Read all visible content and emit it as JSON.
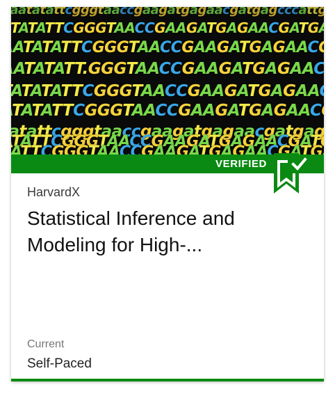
{
  "course_card": {
    "badge_label": "VERIFIED",
    "organization": "HarvardX",
    "title": "Statistical Inference and Modeling for High-...",
    "status_label": "Current",
    "pacing": "Self-Paced",
    "image_icon": "dna-sequence-image",
    "badge_icon": "bookmark-check-icon"
  },
  "colors": {
    "verified_green": "#0a8a12",
    "card_background": "#ffffff",
    "banner_background": "#0a0a0a"
  }
}
